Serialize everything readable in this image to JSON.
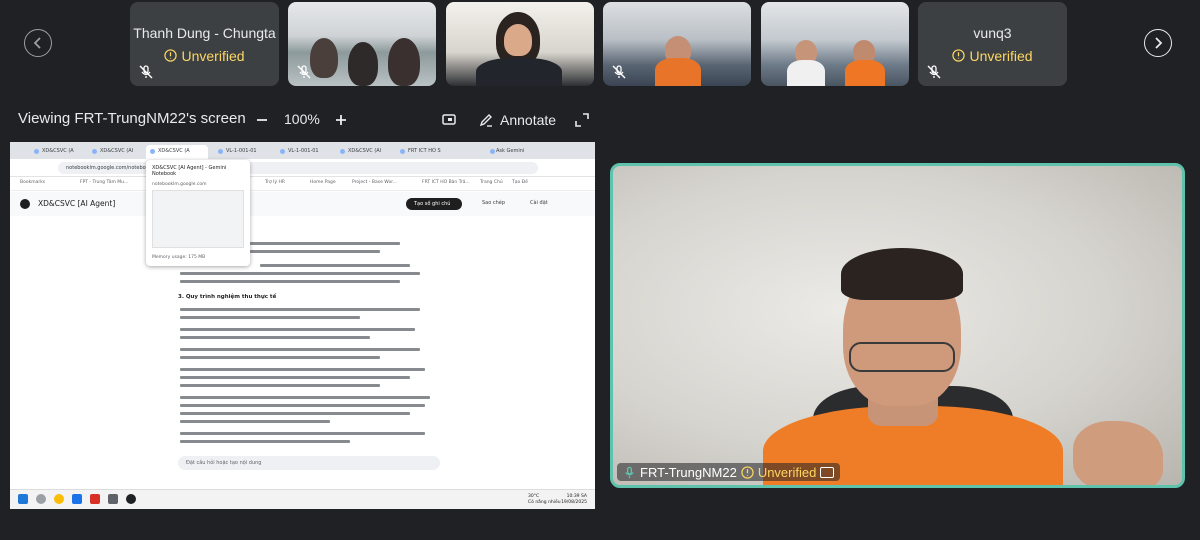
{
  "participants": [
    {
      "name": "Thanh Dung - Chungta",
      "status": "Unverified",
      "muted": true,
      "video": false
    },
    {
      "name": "",
      "status": "",
      "muted": true,
      "video": true
    },
    {
      "name": "",
      "status": "",
      "muted": false,
      "video": true
    },
    {
      "name": "",
      "status": "",
      "muted": true,
      "video": true
    },
    {
      "name": "",
      "status": "",
      "muted": false,
      "video": true
    },
    {
      "name": "vunq3",
      "status": "Unverified",
      "muted": true,
      "video": false
    }
  ],
  "toolbar": {
    "viewing_label": "Viewing FRT-TrungNM22's screen",
    "zoom_level": "100%",
    "annotate_label": "Annotate"
  },
  "shared_screen": {
    "tabs": [
      "XD&CSVC (A",
      "XD&CSVC (AI",
      "XD&CSVC (A",
      "VL-1-001-01",
      "VL-1-001-01",
      "XD&CSVC (Al",
      "FRT ICT HO S"
    ],
    "ask_gemini": "Ask Gemini",
    "address": "notebooklm.google.com/notebook/...?addSource=true&preview=1",
    "bookmarks": [
      "Bookmarks",
      "FPT - Trung Tâm Mu...",
      "Trợ lý HR",
      "Home Page",
      "Project - Base Wor...",
      "FRT ICT HO Bàn Trả...",
      "Trang Chủ",
      "Tạo Đề"
    ],
    "app_title": "XD&CSVC [AI Agent]",
    "create_note": "Tạo số ghi chú",
    "copy_label": "Sao chép",
    "settings_label": "Cài đặt",
    "tooltip_title": "XD&CSVC [AI Agent] - Gemini Notebook",
    "tooltip_url": "notebooklm.google.com",
    "tooltip_memory": "Memory usage: 175 MB",
    "section_heading": "3. Quy trình nghiệm thu thực tế",
    "chat_placeholder": "Đặt câu hỏi hoặc tạo nội dung",
    "weather": "30°C",
    "weather_desc": "Có nắng nhiều",
    "clock_time": "10:39 SA",
    "clock_date": "19/08/2025"
  },
  "speaker": {
    "name": "FRT-TrungNM22",
    "status": "Unverified"
  },
  "colors": {
    "background": "#202124",
    "tile": "#3c4043",
    "unverified": "#fdd663",
    "speaker_border": "#5ec2ad"
  }
}
